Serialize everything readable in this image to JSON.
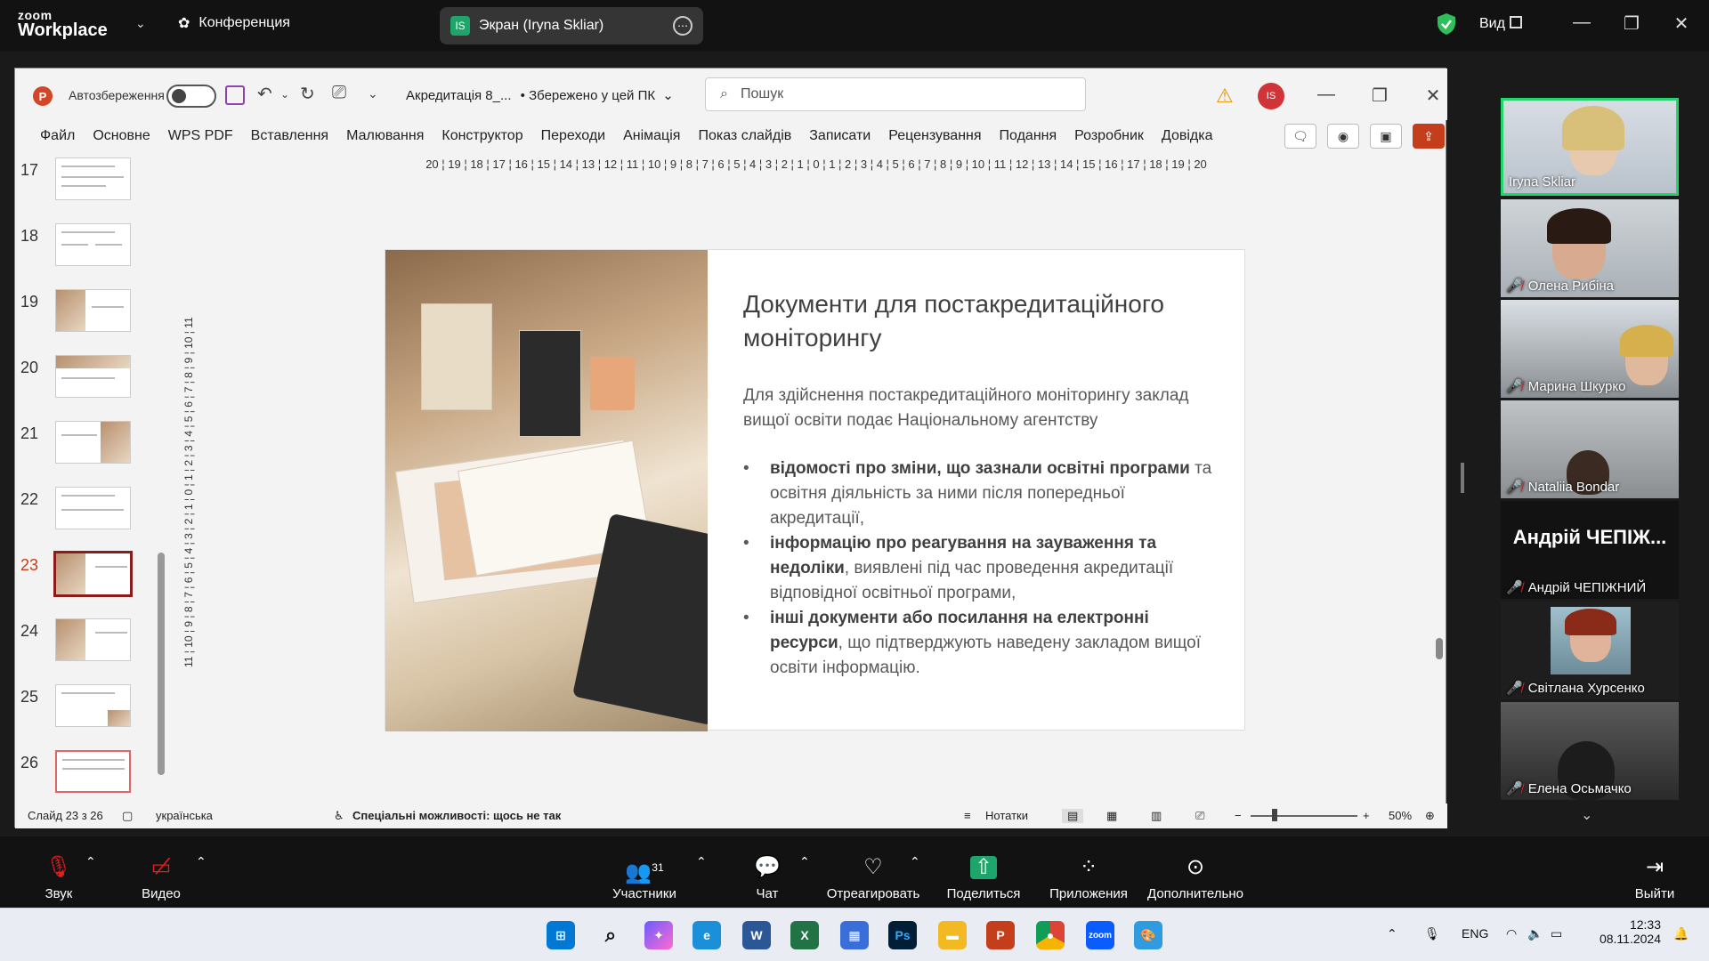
{
  "zoom": {
    "logo_top": "zoom",
    "logo_bottom": "Workplace",
    "meeting_label": "Конференция",
    "share_badge": "IS",
    "share_title": "Экран (Iryna Skliar)",
    "view_label": "Вид"
  },
  "ppt": {
    "logo": "P",
    "autosave_label": "Автозбереження",
    "doc_name": "Акредитація 8_...",
    "save_status": "• Збережено у цей ПК",
    "search_placeholder": "Пошук",
    "avatar": "IS",
    "tabs": [
      "Файл",
      "Основне",
      "WPS PDF",
      "Вставлення",
      "Малювання",
      "Конструктор",
      "Переходи",
      "Анімація",
      "Показ слайдів",
      "Записати",
      "Рецензування",
      "Подання",
      "Розробник",
      "Довідка"
    ],
    "thumbnails": [
      {
        "num": "17"
      },
      {
        "num": "18"
      },
      {
        "num": "19"
      },
      {
        "num": "20"
      },
      {
        "num": "21"
      },
      {
        "num": "22"
      },
      {
        "num": "23"
      },
      {
        "num": "24"
      },
      {
        "num": "25"
      },
      {
        "num": "26"
      }
    ],
    "ruler_h": "20 ¦ 19 ¦ 18 ¦ 17 ¦ 16 ¦ 15 ¦ 14 ¦ 13 ¦ 12 ¦ 11 ¦ 10 ¦ 9 ¦ 8 ¦ 7 ¦ 6 ¦ 5 ¦ 4 ¦ 3 ¦ 2 ¦ 1 ¦ 0 ¦ 1 ¦ 2 ¦ 3 ¦ 4 ¦ 5 ¦ 6 ¦ 7 ¦ 8 ¦ 9 ¦ 10 ¦ 11 ¦ 12 ¦ 13 ¦ 14 ¦ 15 ¦ 16 ¦ 17 ¦ 18 ¦ 19 ¦ 20",
    "ruler_v": "11 ¦ 10 ¦ 9 ¦ 8 ¦ 7 ¦ 6 ¦ 5 ¦ 4 ¦ 3 ¦ 2 ¦ 1 ¦ 0 ¦ 1 ¦ 2 ¦ 3 ¦ 4 ¦ 5 ¦ 6 ¦ 7 ¦ 8 ¦ 9 ¦ 10 ¦ 11",
    "slide": {
      "title": "Документи для постакредитаційного моніторингу",
      "intro": "Для здійснення постакредитаційного моніторингу заклад вищої освіти подає Національному агентству",
      "bullets": [
        {
          "bold": "відомості про зміни, що зазнали освітні програми",
          "rest": " та освітня діяльність за ними після попередньої акредитації,"
        },
        {
          "bold": "інформацію про реагування на зауваження та недоліки",
          "rest": ", виявлені під час проведення акредитації відповідної освітньої програми,"
        },
        {
          "bold": "інші документи або посилання на електронні ресурси",
          "rest": ", що підтверджують наведену закладом вищої освіти інформацію."
        }
      ]
    },
    "status": {
      "slide_counter": "Слайд 23 з 26",
      "language": "українська",
      "accessibility": "Спеціальні можливості: щось не так",
      "notes": "Нотатки",
      "zoom_level": "50%"
    }
  },
  "participants": [
    {
      "name": "Iryna Skliar",
      "muted": false,
      "active": true
    },
    {
      "name": "Олена Рибіна",
      "muted": true
    },
    {
      "name": "Марина Шкурко",
      "muted": true
    },
    {
      "name": "Nataliia Bondar",
      "muted": true
    },
    {
      "name": "Андрій ЧЕПІЖНИЙ",
      "muted": true,
      "big_label": "Андрій ЧЕПІЖ..."
    },
    {
      "name": "Світлана Хурсенко",
      "muted": true
    },
    {
      "name": "Елена Осьмачко",
      "muted": true
    }
  ],
  "controls": {
    "audio": "Звук",
    "video": "Видео",
    "participants_count": "31",
    "participants": "Участники",
    "chat": "Чат",
    "react": "Отреагировать",
    "share": "Поделиться",
    "apps": "Приложения",
    "more": "Дополнительно",
    "leave": "Выйти"
  },
  "taskbar": {
    "lang": "ENG",
    "time": "12:33",
    "date": "08.11.2024"
  },
  "colors": {
    "zoom_bg": "#121212",
    "ppt_accent": "#c43e1c",
    "active_speaker": "#22d66b",
    "mute_red": "#e02020",
    "share_green": "#1ea56b"
  }
}
